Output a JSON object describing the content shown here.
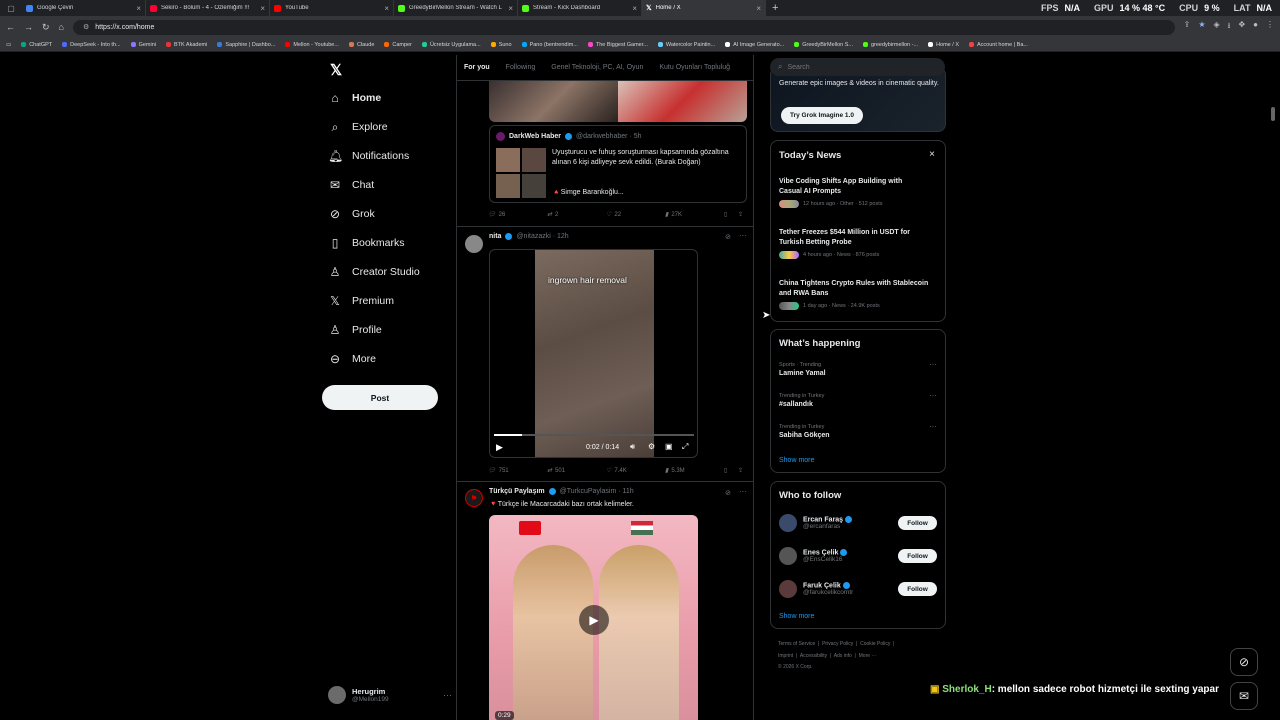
{
  "tabs": [
    {
      "title": "Google Çeviri",
      "color": "#4285f4"
    },
    {
      "title": "Sekiro - Bölüm - 4 - Özlemiğim !!!",
      "color": "#ff0033"
    },
    {
      "title": "YouTube",
      "color": "#ff0000"
    },
    {
      "title": "GreedyBirMellon Stream - Watch L",
      "color": "#53fc18"
    },
    {
      "title": "Stream - Kick Dashboard",
      "color": "#53fc18"
    },
    {
      "title": "Home / X",
      "color": "#ffffff"
    }
  ],
  "stats": {
    "fps_label": "FPS",
    "fps_value": "N/A",
    "gpu_label": "GPU",
    "gpu_value": "14 % 48 °C",
    "cpu_label": "CPU",
    "cpu_value": "9 %",
    "lat_label": "LAT",
    "lat_value": "N/A"
  },
  "address": {
    "url": "https://x.com/home"
  },
  "bookmarks": [
    "ChatGPT",
    "DeepSeek - Into th...",
    "Gemini",
    "BTK Akademi",
    "Sapphire | Dashbo...",
    "Mellon - Youtube...",
    "Claude",
    "Camper",
    "Ücretsiz Uygulama...",
    "Suno",
    "Pano (bentrendim...",
    "The Biggest Gamer...",
    "Watercolor Paintin...",
    "AI Image Generato...",
    "GreedyBirMellon S...",
    "greedybirmellon -...",
    "Home / X",
    "Account home | Ba..."
  ],
  "nav": {
    "home": "Home",
    "explore": "Explore",
    "notifications": "Notifications",
    "chat": "Chat",
    "grok": "Grok",
    "bookmarks": "Bookmarks",
    "creator": "Creator Studio",
    "premium": "Premium",
    "profile": "Profile",
    "more": "More",
    "post": "Post"
  },
  "user": {
    "name": "Herugrim",
    "handle": "@Mellon199"
  },
  "feed_tabs": {
    "for_you": "For you",
    "following": "Following",
    "general": "Genel Teknoloji, PC, AI, Oyun",
    "games": "Kutu Oyunları Topluluğ"
  },
  "post1": {
    "quoted": {
      "name": "DarkWeb Haber",
      "handle": "@darkwebhaber · 5h",
      "text": "Uyuşturucu ve fuhuş soruşturması kapsamında gözaltına alınan 6 kişi adliyeye sevk edildi. (Burak Doğan)",
      "sub": "🔺Simge Barankoğlu..."
    },
    "stats": {
      "replies": "26",
      "reposts": "2",
      "likes": "22",
      "views": "27K"
    }
  },
  "post2": {
    "name": "nita",
    "handle": "@nitazazki · 12h",
    "video_caption": "ingrown hair removal",
    "time": "0:02 / 0:14",
    "stats": {
      "replies": "751",
      "reposts": "501",
      "likes": "7.4K",
      "views": "5.3M"
    }
  },
  "post3": {
    "name": "Türkçü Paylaşım",
    "handle": "@TurkcuPaylasim · 11h",
    "text": "🔻Türkçe ile Macarcadaki bazı ortak kelimeler.",
    "duration": "0:29"
  },
  "search": {
    "placeholder": "Search"
  },
  "grok_promo": {
    "text": "Generate epic images & videos in cinematic quality.",
    "button": "Try Grok Imagine 1.0"
  },
  "news": {
    "title": "Today’s News",
    "items": [
      {
        "headline": "Vibe Coding Shifts App Building with Casual AI Prompts",
        "meta": "12 hours ago · Other · 512 posts"
      },
      {
        "headline": "Tether Freezes $544 Million in USDT for Turkish Betting Probe",
        "meta": "4 hours ago · News · 876 posts"
      },
      {
        "headline": "China Tightens Crypto Rules with Stablecoin and RWA Bans",
        "meta": "1 day ago · News · 24.9K posts"
      }
    ]
  },
  "happening": {
    "title": "What’s happening",
    "items": [
      {
        "context": "Sports · Trending",
        "topic": "Lamine Yamal"
      },
      {
        "context": "Trending in Turkey",
        "topic": "#sallandık"
      },
      {
        "context": "Trending in Turkey",
        "topic": "Sabiha Gökçen"
      }
    ],
    "show_more": "Show more"
  },
  "who_to_follow": {
    "title": "Who to follow",
    "follow_label": "Follow",
    "show_more": "Show more",
    "users": [
      {
        "name": "Ercan Faraş",
        "handle": "@ercanfaras"
      },
      {
        "name": "Enes Çelik",
        "handle": "@EnsCelik16"
      },
      {
        "name": "Faruk Çelik",
        "handle": "@farukcelikcomtr"
      }
    ]
  },
  "footer": {
    "terms": "Terms of Service",
    "privacy": "Privacy Policy",
    "cookie": "Cookie Policy",
    "imprint": "Imprint",
    "accessibility": "Accessibility",
    "ads": "Ads info",
    "more": "More ···",
    "copyright": "© 2026 X Corp."
  },
  "chat_overlay": {
    "user": "Sherlok_H",
    "message": ": mellon sadece robot hizmetçi ile sexting yapar"
  }
}
